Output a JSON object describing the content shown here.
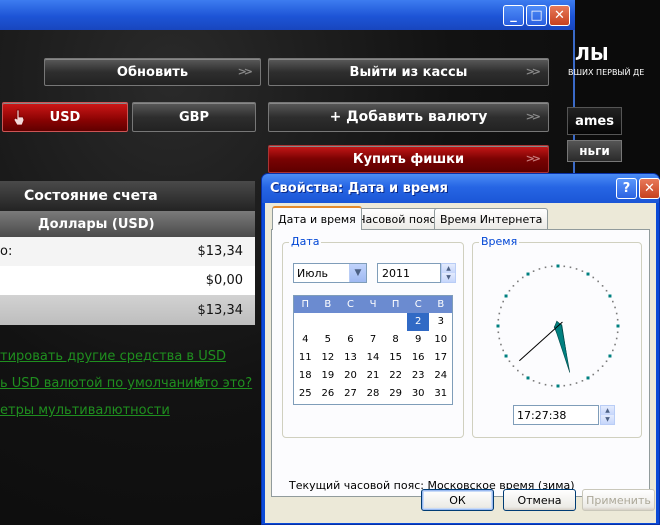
{
  "cashier": {
    "title_buttons": {
      "minimize": "_",
      "maximize": "□",
      "close": "✕"
    },
    "refresh_label": "Обновить",
    "exit_cashier_label": "Выйти из кассы",
    "usd_label": "USD",
    "gbp_label": "GBP",
    "add_currency_label": "+ Добавить валюту",
    "buy_chips_label": "Купить фишки",
    "arrow_glyph": ">>",
    "account_header": "Состояние счета",
    "account_sub": "Доллары (USD)",
    "rows": [
      {
        "label": "о:",
        "value": "$13,34"
      },
      {
        "label": "",
        "value": "$0,00"
      },
      {
        "label": "",
        "value": "$13,34"
      }
    ],
    "links": {
      "convert": "тировать другие средства в USD",
      "default_currency": "ь USD валютой по умолчанию",
      "what_is_this": "Что это?",
      "multicurrency": "етры мультивалютности"
    },
    "right_strip": {
      "big_title": "ЛЫ",
      "subtitle": "ВШИХ ПЕРВЫЙ ДЕ",
      "tab1": "ames",
      "tab2": "ньги"
    }
  },
  "dialog": {
    "title": "Свойства: Дата и время",
    "help_glyph": "?",
    "close_glyph": "✕",
    "tabs": [
      {
        "label": "Дата и время",
        "active": true
      },
      {
        "label": "Часовой пояс",
        "active": false
      },
      {
        "label": "Время Интернета",
        "active": false
      }
    ],
    "date_group_label": "Дата",
    "month": "Июль",
    "year": "2011",
    "weekdays": [
      "П",
      "В",
      "С",
      "Ч",
      "П",
      "С",
      "В"
    ],
    "weeks": [
      [
        "",
        "",
        "",
        "",
        "",
        "2",
        "3"
      ],
      [
        "4",
        "5",
        "6",
        "7",
        "8",
        "9",
        "10"
      ],
      [
        "11",
        "12",
        "13",
        "14",
        "15",
        "16",
        "17"
      ],
      [
        "18",
        "19",
        "20",
        "21",
        "22",
        "23",
        "24"
      ],
      [
        "25",
        "26",
        "27",
        "28",
        "29",
        "30",
        "31"
      ]
    ],
    "selected_day": "2",
    "time_group_label": "Время",
    "time": "17:27:38",
    "clock": {
      "hours": 17,
      "minutes": 27,
      "seconds": 38
    },
    "timezone_text": "Текущий часовой пояс: Московское время (зима)",
    "ok_label": "ОК",
    "cancel_label": "Отмена",
    "apply_label": "Применить"
  }
}
